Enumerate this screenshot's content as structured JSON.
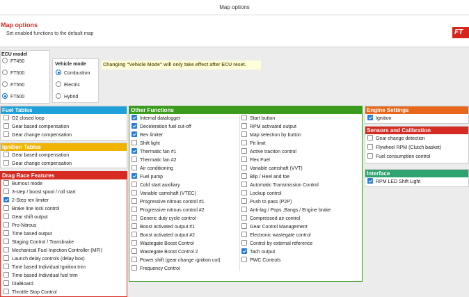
{
  "window": {
    "title": "Map options"
  },
  "header": {
    "title": "Map options",
    "subtitle": "Set enabled functions to the default map",
    "logo_text": "FT"
  },
  "ecu": {
    "title": "ECU model",
    "options": [
      "FT450",
      "FT500",
      "FT550",
      "FT600"
    ],
    "selected": 3
  },
  "vehicle_mode": {
    "title": "Vehicle mode",
    "options": [
      "Combustion",
      "Electric",
      "Hybrid"
    ],
    "selected": 0
  },
  "notice": "Changing \"Vehicle Mode\" will only take effect after ECU reset.",
  "colors": {
    "fuel": "#1fa0d8",
    "ignition": "#f0b400",
    "drag": "#d62b22",
    "other": "#3a9b1d",
    "engine": "#e8671a",
    "sensors": "#d62b22",
    "interface": "#2fa36f",
    "accent": "#d7261e"
  },
  "fuel_tables": {
    "title": "Fuel Tables",
    "items": [
      {
        "label": "O2 closed loop",
        "checked": false
      },
      {
        "label": "Gear based compensation",
        "checked": false
      },
      {
        "label": "Gear change compensation",
        "checked": false
      }
    ]
  },
  "ignition_tables": {
    "title": "Ignition Tables",
    "items": [
      {
        "label": "Gear based compensation",
        "checked": false
      },
      {
        "label": "Gear change compensation",
        "checked": false
      }
    ]
  },
  "drag_race": {
    "title": "Drag Race Features",
    "items": [
      {
        "label": "Burnout mode",
        "checked": false
      },
      {
        "label": "3-step / boost spool / roll start",
        "checked": false
      },
      {
        "label": "2-Step rev limiter",
        "checked": true
      },
      {
        "label": "Brake line lock control",
        "checked": false
      },
      {
        "label": "Gear shift output",
        "checked": false
      },
      {
        "label": "Pro-Nitrous",
        "checked": false
      },
      {
        "label": "Time based output",
        "checked": false
      },
      {
        "label": "Staging Control / Transbrake",
        "checked": false
      },
      {
        "label": "Mechanical Fuel Injection Controller (MFI)",
        "checked": false
      },
      {
        "label": "Launch delay controls (delay box)",
        "checked": false
      },
      {
        "label": "Time based Individual Ignition trim",
        "checked": false
      },
      {
        "label": "Time based Individual fuel trim",
        "checked": false
      },
      {
        "label": "DialBoard",
        "checked": false
      },
      {
        "label": "Throttle Stop Control",
        "checked": false
      }
    ]
  },
  "other_functions": {
    "title": "Other Functions",
    "col1": [
      {
        "label": "Internal datalogger",
        "checked": true
      },
      {
        "label": "Deceleration fuel cut-off",
        "checked": true
      },
      {
        "label": "Rev limiter",
        "checked": true
      },
      {
        "label": "Shift light",
        "checked": false
      },
      {
        "label": "Thermatic fan #1",
        "checked": true
      },
      {
        "label": "Thermatic fan #2",
        "checked": false
      },
      {
        "label": "Air conditioning",
        "checked": false
      },
      {
        "label": "Fuel pump",
        "checked": true
      },
      {
        "label": "Cold start auxiliary",
        "checked": false
      },
      {
        "label": "Variable camshaft (VTEC)",
        "checked": false
      },
      {
        "label": "Progressive nitrous control #1",
        "checked": false
      },
      {
        "label": "Progressive nitrous control #2",
        "checked": false
      },
      {
        "label": "Generic duty cycle control",
        "checked": false
      },
      {
        "label": "Boost activated output #1",
        "checked": false
      },
      {
        "label": "Boost activated output #2",
        "checked": false
      },
      {
        "label": "Wastegate Boost Control",
        "checked": false
      },
      {
        "label": "Wastegate Boost Control 2",
        "checked": false
      },
      {
        "label": "Power shift (gear change ignition cut)",
        "checked": false
      },
      {
        "label": "Frequency Control",
        "checked": false
      }
    ],
    "col2": [
      {
        "label": "Start button",
        "checked": false
      },
      {
        "label": "RPM activated output",
        "checked": false
      },
      {
        "label": "Map selection by button",
        "checked": false
      },
      {
        "label": "Pit limit",
        "checked": false
      },
      {
        "label": "Active traction control",
        "checked": false
      },
      {
        "label": "Flex Fuel",
        "checked": false
      },
      {
        "label": "Variable camshaft (VVT)",
        "checked": false
      },
      {
        "label": "Blip / Heel and toe",
        "checked": false
      },
      {
        "label": "Automatic Transmission Control",
        "checked": false
      },
      {
        "label": "Lockup control",
        "checked": false
      },
      {
        "label": "Push to pass (P2P)",
        "checked": false
      },
      {
        "label": "Anti-lag / Pops ,Bangs / Engine brake",
        "checked": false
      },
      {
        "label": "Compressed air control",
        "checked": false
      },
      {
        "label": "Gear Control Management",
        "checked": false
      },
      {
        "label": "Electronic wastegate control",
        "checked": false
      },
      {
        "label": "Control by external reference",
        "checked": false
      },
      {
        "label": "Tach output",
        "checked": true
      },
      {
        "label": "PWC Controls",
        "checked": false
      }
    ]
  },
  "engine_settings": {
    "title": "Engine Settings",
    "items": [
      {
        "label": "Ignition",
        "checked": true
      }
    ]
  },
  "sensors": {
    "title": "Sensors and Calibration",
    "items": [
      {
        "label": "Gear change detection",
        "checked": false
      },
      {
        "label": "Flywheel RPM (Clutch basket)",
        "checked": false
      },
      {
        "label": "Fuel consumption control",
        "checked": false
      }
    ]
  },
  "interface": {
    "title": "Interface",
    "items": [
      {
        "label": "RPM LED Shift Light",
        "checked": true
      }
    ]
  }
}
